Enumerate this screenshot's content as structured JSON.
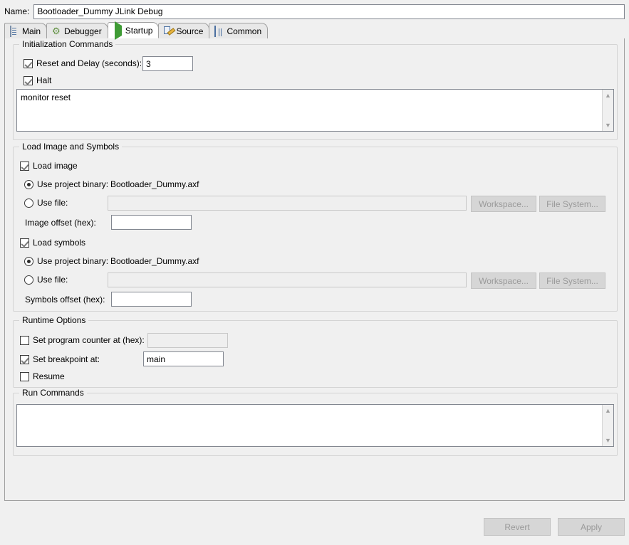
{
  "window": {
    "name_label": "Name:",
    "name_value": "Bootloader_Dummy JLink Debug"
  },
  "tabs": [
    {
      "label": "Main",
      "icon": "document-icon",
      "active": false
    },
    {
      "label": "Debugger",
      "icon": "gear-icon",
      "active": false
    },
    {
      "label": "Startup",
      "icon": "play-icon",
      "active": true
    },
    {
      "label": "Source",
      "icon": "source-icon",
      "active": false
    },
    {
      "label": "Common",
      "icon": "table-icon",
      "active": false
    }
  ],
  "init_commands": {
    "group_title": "Initialization Commands",
    "reset_delay_label": "Reset and Delay (seconds):",
    "reset_delay_checked": true,
    "reset_delay_value": "3",
    "halt_label": "Halt",
    "halt_checked": true,
    "commands_text": "monitor reset"
  },
  "load_image_symbols": {
    "group_title": "Load Image and Symbols",
    "load_image_label": "Load image",
    "load_image_checked": true,
    "image_use_project_binary_label": "Use project binary:",
    "image_project_binary_value": "Bootloader_Dummy.axf",
    "image_use_file_label": "Use file:",
    "image_use_file_value": "",
    "image_workspace_button": "Workspace...",
    "image_filesystem_button": "File System...",
    "image_offset_label": "Image offset (hex):",
    "image_offset_value": "",
    "load_symbols_label": "Load symbols",
    "load_symbols_checked": true,
    "symbols_use_project_binary_label": "Use project binary:",
    "symbols_project_binary_value": "Bootloader_Dummy.axf",
    "symbols_use_file_label": "Use file:",
    "symbols_use_file_value": "",
    "symbols_workspace_button": "Workspace...",
    "symbols_filesystem_button": "File System...",
    "symbols_offset_label": "Symbols offset (hex):",
    "symbols_offset_value": ""
  },
  "runtime_options": {
    "group_title": "Runtime Options",
    "set_pc_label": "Set program counter at (hex):",
    "set_pc_checked": false,
    "set_pc_value": "",
    "set_breakpoint_label": "Set breakpoint at:",
    "set_breakpoint_checked": true,
    "set_breakpoint_value": "main",
    "resume_label": "Resume",
    "resume_checked": false
  },
  "run_commands": {
    "group_title": "Run Commands",
    "commands_text": ""
  },
  "footer": {
    "revert_label": "Revert",
    "apply_label": "Apply",
    "revert_enabled": false,
    "apply_enabled": false
  },
  "scrollbar": {
    "up_glyph": "▲",
    "down_glyph": "▼"
  }
}
